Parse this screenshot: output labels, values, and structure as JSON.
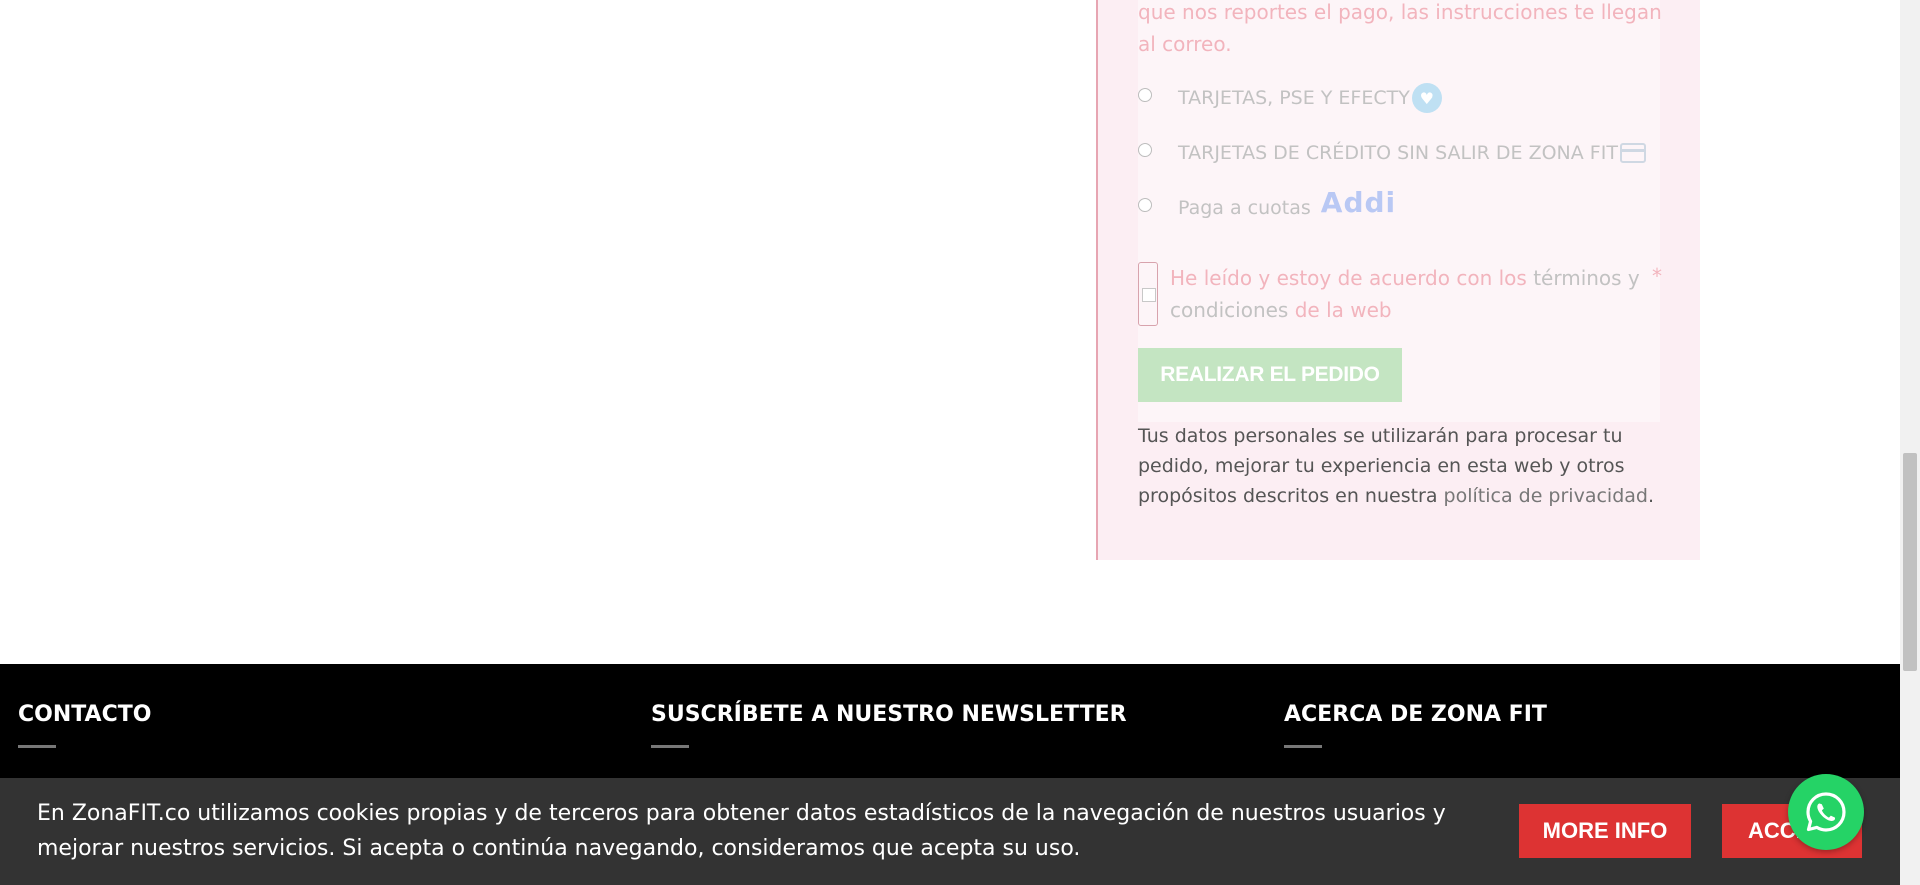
{
  "checkout": {
    "bank_note": "que nos reportes el pago, las instrucciones te llegan al correo.",
    "payment_options": [
      {
        "label": "TARJETAS, PSE Y EFECTY",
        "icon": "handshake-icon"
      },
      {
        "label": "TARJETAS DE CRÉDITO SIN SALIR DE ZONA FIT",
        "icon": "credit-card-icon"
      },
      {
        "label": "Paga a cuotas",
        "icon": "addi-logo",
        "logo_text": "Addi"
      }
    ],
    "terms": {
      "prefix": "He leído y estoy de acuerdo con los ",
      "link": "términos y condiciones",
      "suffix": " de la web",
      "required": "*"
    },
    "order_button": "REALIZAR EL PEDIDO",
    "privacy": {
      "text": "Tus datos personales se utilizarán para procesar tu pedido, mejorar tu experiencia en esta web y otros propósitos descritos en nuestra ",
      "link": "política de privacidad",
      "end": "."
    }
  },
  "footer": {
    "columns": [
      {
        "heading": "CONTACTO"
      },
      {
        "heading": "SUSCRÍBETE A NUESTRO NEWSLETTER"
      },
      {
        "heading": "ACERCA DE ZONA FIT"
      }
    ]
  },
  "cookie": {
    "text": "En ZonaFIT.co utilizamos cookies propias y de terceros para obtener datos estadísticos de la navegación de nuestros usuarios y mejorar nuestros servicios. Si acepta o continúa navegando, consideramos que acepta su uso.",
    "more_info": "MORE INFO",
    "accept": "ACCEPT"
  },
  "colors": {
    "order_button": "#c4e5c2",
    "cookie_button": "#dd3333",
    "whatsapp": "#25d366",
    "footer": "#000000",
    "cookie_bar": "#333333"
  }
}
